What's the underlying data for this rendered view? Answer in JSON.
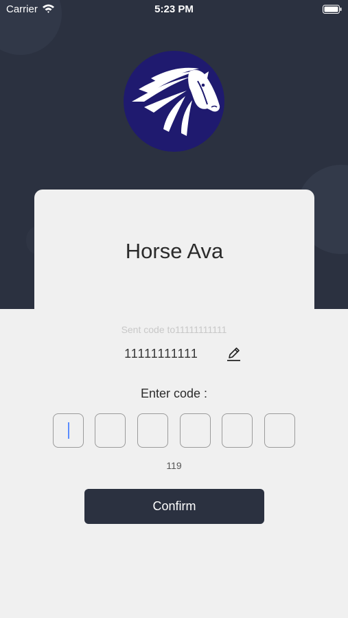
{
  "status_bar": {
    "carrier": "Carrier",
    "time": "5:23 PM"
  },
  "logo": {
    "icon": "horse-head-icon",
    "background_color": "#1f1a6f"
  },
  "app": {
    "title": "Horse Ava"
  },
  "verification": {
    "sent_label": "Sent code to11111111111",
    "phone_number": "11111111111",
    "edit_icon": "pencil-icon",
    "enter_code_label": "Enter code :",
    "code_digits": [
      "",
      "",
      "",
      "",
      "",
      ""
    ],
    "countdown": "119",
    "confirm_label": "Confirm"
  },
  "colors": {
    "header_background": "#2b3140",
    "page_background": "#f0f0f0",
    "button_background": "#2b3140",
    "caret": "#5a8cff"
  }
}
